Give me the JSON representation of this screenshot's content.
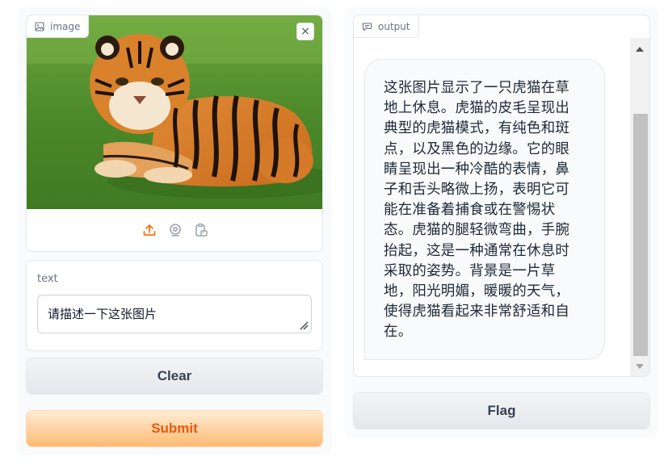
{
  "image_input": {
    "label": "image",
    "clear_symbol": "×",
    "sources": [
      "upload-icon",
      "webcam-icon",
      "clipboard-icon"
    ]
  },
  "text_input": {
    "label": "text",
    "value": "请描述一下这张图片"
  },
  "buttons": {
    "clear": "Clear",
    "submit": "Submit",
    "flag": "Flag"
  },
  "output": {
    "label": "output",
    "lines": [
      "这张图片显示了一只虎猫在草",
      "地上休息。虎猫的皮毛呈现出",
      "典型的虎猫模式，有纯色和斑",
      "点，以及黑色的边缘。它的眼",
      "睛呈现出一种冷酷的表情，鼻",
      "子和舌头略微上扬，表明它可",
      "能在准备着捕食或在警惕状",
      "态。虎猫的腿轻微弯曲，手腕",
      "抬起，这是一种通常在休息时",
      "采取的姿势。背景是一片草",
      "地，阳光明媚，暖暖的天气，",
      "使得虎猫看起来非常舒适和自",
      "在。"
    ]
  },
  "colors": {
    "accent": "#f97316",
    "submit_text": "#ea580c",
    "grass": "#4f8a2b",
    "tiger_orange": "#d9822b"
  }
}
